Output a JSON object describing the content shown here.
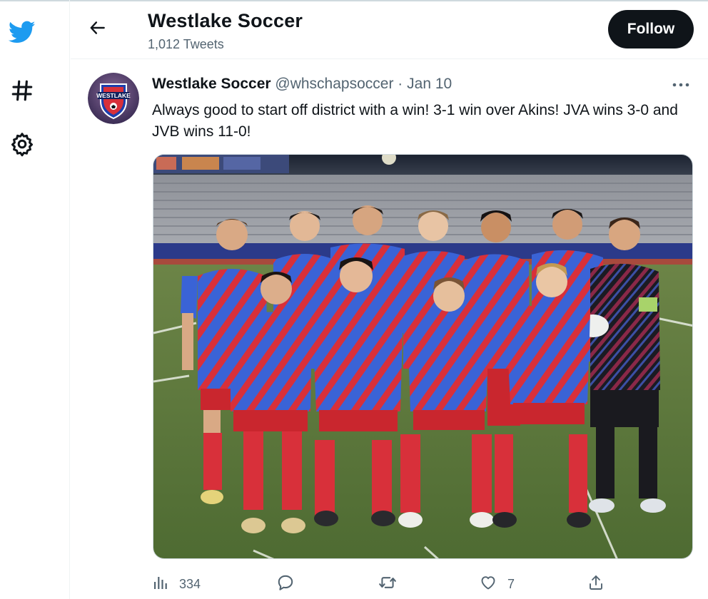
{
  "app": {
    "nav": [
      {
        "icon": "twitter-logo-icon"
      },
      {
        "icon": "hashtag-icon"
      },
      {
        "icon": "settings-gear-icon"
      }
    ]
  },
  "header": {
    "title": "Westlake Soccer",
    "subtitle": "1,012 Tweets",
    "follow_label": "Follow"
  },
  "tweet": {
    "author_name": "Westlake Soccer",
    "handle": "@whschapsoccer",
    "separator": "·",
    "date": "Jan 10",
    "text": "Always good to start off district with a win! 3-1 win over Akins! JVA wins 3-0 and JVB wins 11-0!",
    "avatar_logo_text": "WESTLAKE",
    "stats": {
      "views": "334",
      "likes": "7"
    }
  },
  "colors": {
    "twitter_blue": "#1d9bf0",
    "text_primary": "#0f1419",
    "text_secondary": "#536471",
    "follow_bg": "#0f1419",
    "jersey_blue": "#3a63d6",
    "jersey_red": "#d8303a",
    "pitch_green": "#5d7a3c"
  }
}
